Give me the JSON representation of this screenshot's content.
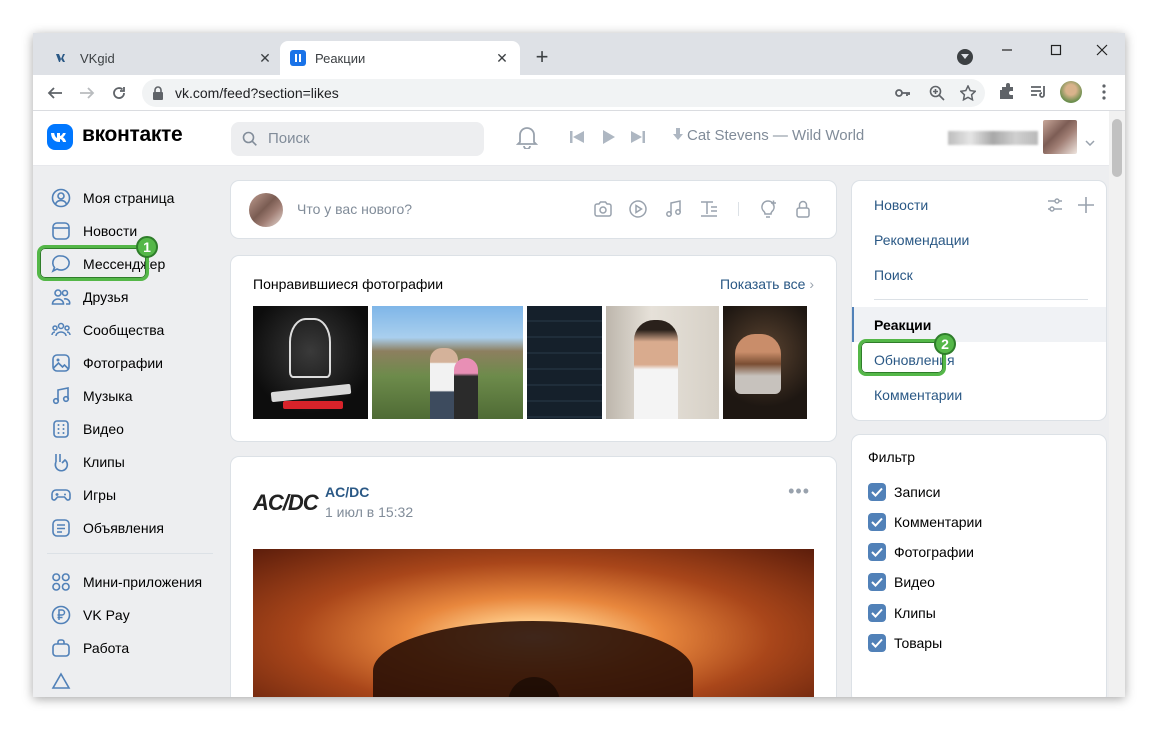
{
  "browser": {
    "tabs": [
      {
        "title": "VKgid",
        "active": false
      },
      {
        "title": "Реакции",
        "active": true
      }
    ],
    "url": "vk.com/feed?section=likes"
  },
  "header": {
    "logo_text": "вконтакте",
    "search_placeholder": "Поиск",
    "now_playing": "Cat Stevens — Wild World"
  },
  "left_nav": {
    "items": [
      {
        "label": "Моя страница",
        "icon": "user-circle-icon"
      },
      {
        "label": "Новости",
        "icon": "newsfeed-icon"
      },
      {
        "label": "Мессенджер",
        "icon": "message-icon"
      },
      {
        "label": "Друзья",
        "icon": "friends-icon"
      },
      {
        "label": "Сообщества",
        "icon": "communities-icon"
      },
      {
        "label": "Фотографии",
        "icon": "photos-icon"
      },
      {
        "label": "Музыка",
        "icon": "music-icon"
      },
      {
        "label": "Видео",
        "icon": "video-icon"
      },
      {
        "label": "Клипы",
        "icon": "clips-icon"
      },
      {
        "label": "Игры",
        "icon": "games-icon"
      },
      {
        "label": "Объявления",
        "icon": "ads-icon"
      }
    ],
    "items2": [
      {
        "label": "Мини-приложения",
        "icon": "apps-icon"
      },
      {
        "label": "VK Pay",
        "icon": "vkpay-icon"
      },
      {
        "label": "Работа",
        "icon": "work-icon"
      }
    ]
  },
  "annotations": {
    "badge1": "1",
    "badge2": "2"
  },
  "composer": {
    "placeholder": "Что у вас нового?"
  },
  "liked_photos": {
    "title": "Понравившиеся фотографии",
    "show_all": "Показать все"
  },
  "post": {
    "logo_text": "AC/DC",
    "author": "AC/DC",
    "date": "1 июл в 15:32",
    "menu": "•••"
  },
  "right_nav": {
    "items": [
      {
        "label": "Новости",
        "active": false
      },
      {
        "label": "Рекомендации",
        "active": false
      },
      {
        "label": "Поиск",
        "active": false
      },
      {
        "label": "Реакции",
        "active": true
      },
      {
        "label": "Обновления",
        "active": false
      },
      {
        "label": "Комментарии",
        "active": false
      }
    ]
  },
  "filter": {
    "title": "Фильтр",
    "options": [
      {
        "label": "Записи",
        "checked": true
      },
      {
        "label": "Комментарии",
        "checked": true
      },
      {
        "label": "Фотографии",
        "checked": true
      },
      {
        "label": "Видео",
        "checked": true
      },
      {
        "label": "Клипы",
        "checked": true
      },
      {
        "label": "Товары",
        "checked": true
      }
    ]
  },
  "colors": {
    "accent": "#0077ff",
    "link": "#2a5885",
    "highlight": "#54b748"
  }
}
